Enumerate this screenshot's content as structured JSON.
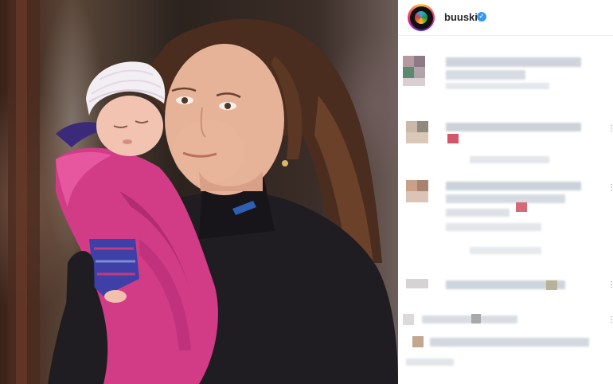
{
  "post": {
    "account": {
      "username": "buuski",
      "verified": true,
      "verified_glyph": "✓",
      "more_glyph": "···",
      "avatar_icon": "avatar-ring-icon"
    },
    "photo": {
      "sweater_logo_color": "#2f5fb3",
      "blanket_color": "#d23c86",
      "hat_color": "#f3eef2"
    },
    "comments_note": "",
    "comment_menu_glyph": "⋯",
    "colors": {
      "text": "#262626",
      "verified": "#3897f0",
      "divider": "#efefef"
    }
  }
}
